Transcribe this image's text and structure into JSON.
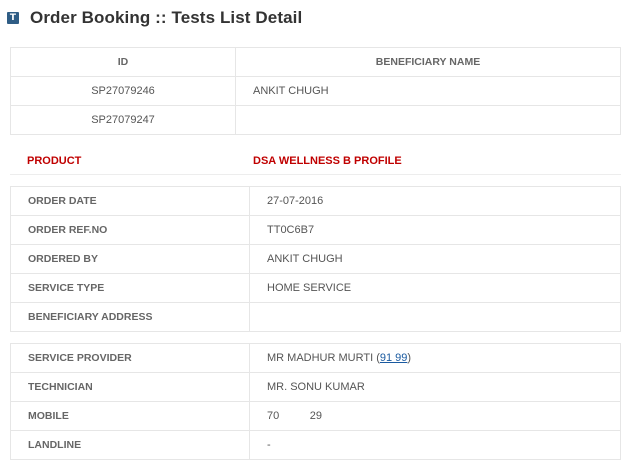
{
  "header": {
    "icon_letter": "T",
    "title": "Order Booking :: Tests List Detail"
  },
  "beneficiaries": {
    "columns": [
      "ID",
      "BENEFICIARY NAME"
    ],
    "rows": [
      {
        "id": "SP27079246",
        "name": "ANKIT CHUGH"
      },
      {
        "id": "SP27079247",
        "name": ""
      }
    ]
  },
  "product": {
    "label": "PRODUCT",
    "value": "DSA WELLNESS B PROFILE",
    "color": "#c00000"
  },
  "order_details": [
    {
      "label": "ORDER DATE",
      "value": "27-07-2016"
    },
    {
      "label": "ORDER REF.NO",
      "value": "TT0C6B7"
    },
    {
      "label": "ORDERED BY",
      "value": "ANKIT CHUGH"
    },
    {
      "label": "SERVICE TYPE",
      "value": "HOME SERVICE"
    },
    {
      "label": "BENEFICIARY ADDRESS",
      "value": ""
    }
  ],
  "service": {
    "provider_label": "SERVICE PROVIDER",
    "provider_name": "MR MADHUR MURTI",
    "provider_open": "(",
    "provider_phone": "91          99",
    "provider_close": ")",
    "technician_label": "TECHNICIAN",
    "technician_value": "MR. SONU KUMAR",
    "mobile_label": "MOBILE",
    "mobile_value": "70          29",
    "landline_label": "LANDLINE",
    "landline_value": "-"
  }
}
